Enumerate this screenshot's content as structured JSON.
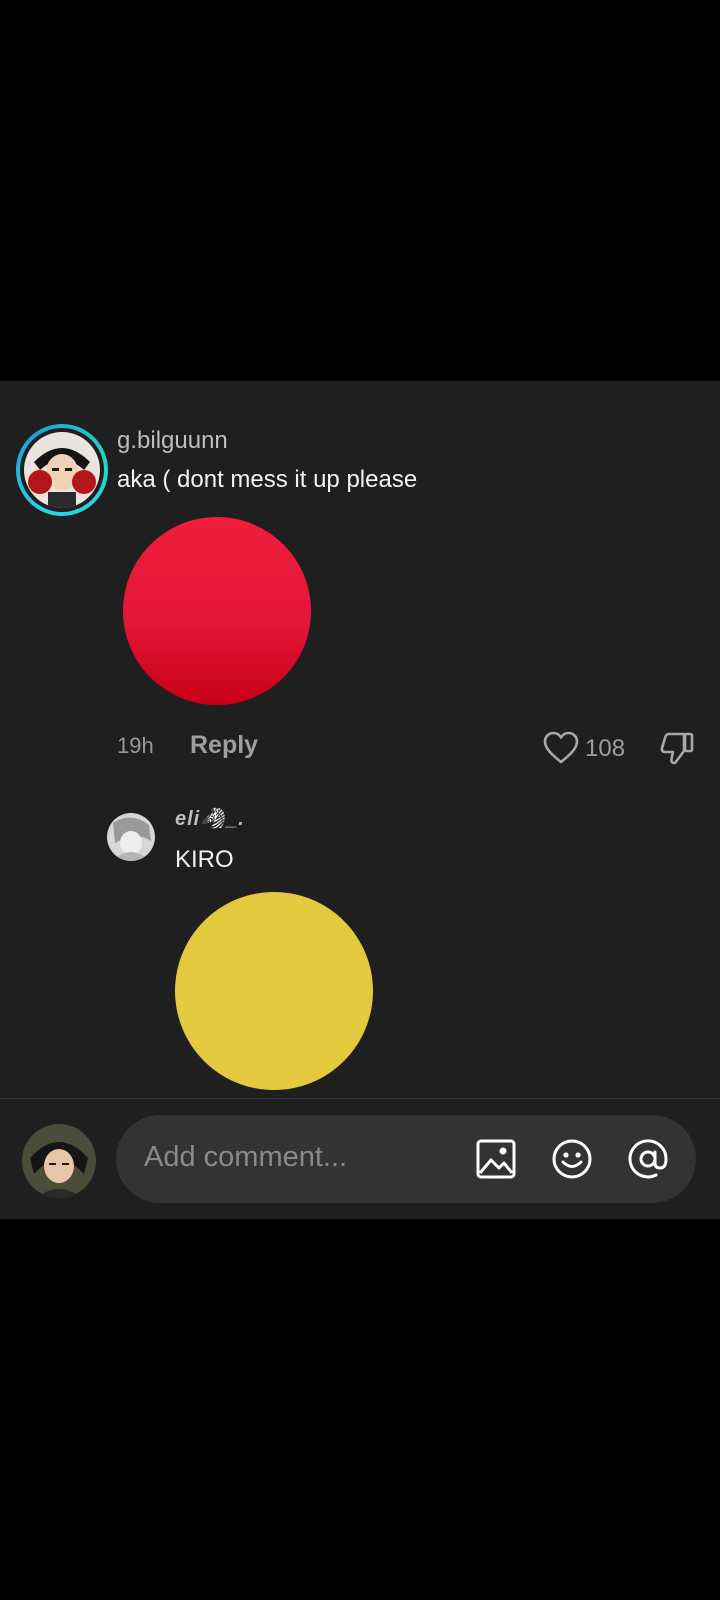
{
  "comment": {
    "username": "g.bilguunn",
    "text": "aka ( dont mess it up please",
    "sticker_color": "#e5163a",
    "time": "19h",
    "reply_label": "Reply",
    "like_count": "108"
  },
  "reply": {
    "username": "eli🦓_.",
    "text": "KIRO",
    "sticker_color": "#e2c93e"
  },
  "composer": {
    "placeholder": "Add comment...",
    "icons": [
      "image-icon",
      "emoji-icon",
      "mention-icon"
    ]
  },
  "colors": {
    "panel_bg": "#1f1f1f",
    "avatar_ring": "#2bd3e8",
    "input_bg": "#333333"
  }
}
